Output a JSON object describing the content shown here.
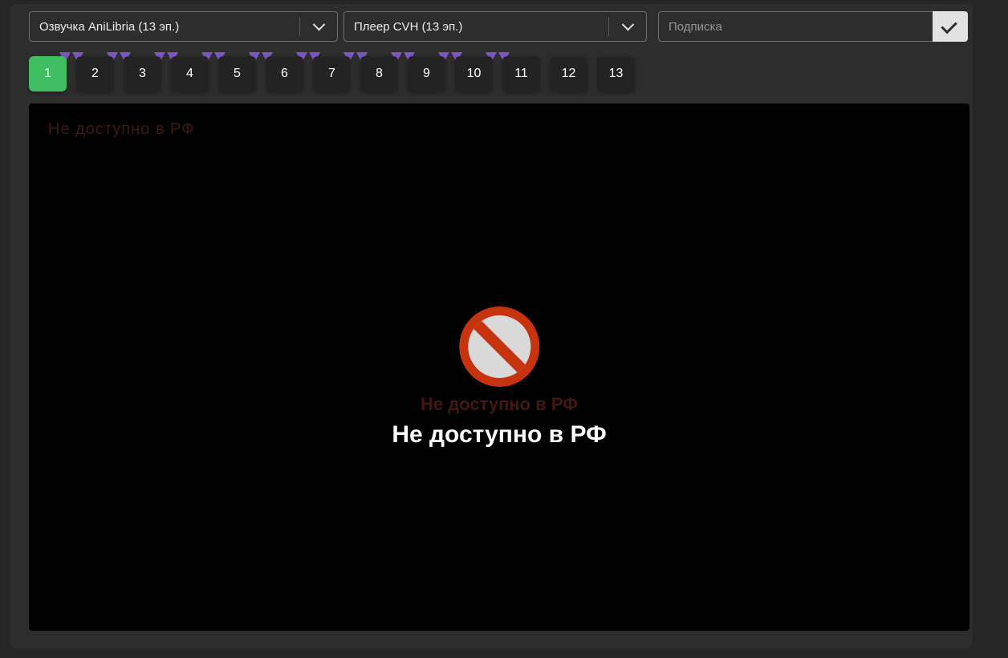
{
  "controls": {
    "voice_select": "Озвучка AniLibria (13 эп.)",
    "player_select": "Плеер CVH (13 эп.)",
    "subscription_placeholder": "Подписка"
  },
  "episodes": {
    "active": "1",
    "labels": [
      "1",
      "2",
      "3",
      "4",
      "5",
      "6",
      "7",
      "8",
      "9",
      "10",
      "11",
      "12",
      "13"
    ],
    "marker_after": [
      1,
      2,
      3,
      4,
      5,
      6,
      7,
      8,
      9,
      10
    ]
  },
  "player": {
    "corner_text": "Не доступно в РФ",
    "ghost_message": "Не доступно в РФ",
    "message": "Не доступно в РФ"
  },
  "icons": {
    "voice_chevron": "chevron-down",
    "player_chevron": "chevron-down",
    "subscribe_check": "check",
    "blocked": "no-entry"
  },
  "colors": {
    "accent_green": "#3ebd61",
    "marker_purple": "#7d55c2",
    "ban_red": "#c7330e"
  }
}
